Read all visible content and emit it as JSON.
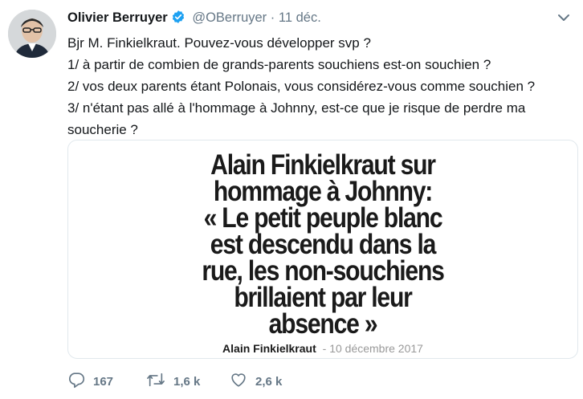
{
  "tweet": {
    "author_name": "Olivier Berruyer",
    "handle": "@OBerruyer",
    "separator": "·",
    "date": "11 déc.",
    "lines": [
      "Bjr M. Finkielkraut. Pouvez-vous développer svp ?",
      "1/ à partir de combien de grands-parents souchiens est-on souchien ?",
      "2/ vos deux parents étant Polonais, vous considérez-vous comme souchien ?",
      "3/ n'étant pas allé à l'hommage à Johnny, est-ce que je risque de perdre ma",
      "soucherie ?"
    ]
  },
  "media": {
    "quote_lines": [
      "Alain Finkielkraut sur",
      "hommage à Johnny:",
      "« Le petit peuple blanc",
      "est descendu dans la",
      "rue, les non-souchiens",
      "brillaient par leur",
      "absence »"
    ],
    "attribution_author": "Alain Finkielkraut",
    "attribution_date": "- 10 décembre 2017"
  },
  "actions": {
    "reply_count": "167",
    "retweet_count": "1,6 k",
    "like_count": "2,6 k"
  },
  "colors": {
    "verified_blue": "#1da1f2",
    "muted_text": "#657786",
    "border": "#e1e8ed"
  },
  "icons": [
    "avatar-photo",
    "verified-badge-icon",
    "chevron-down-icon",
    "reply-icon",
    "retweet-icon",
    "like-icon"
  ]
}
